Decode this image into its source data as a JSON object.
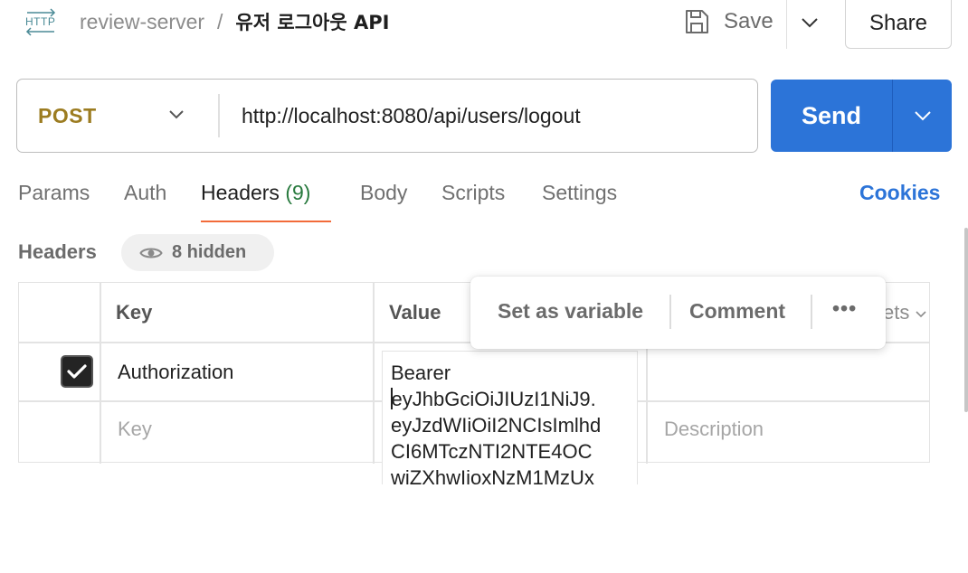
{
  "breadcrumb": {
    "icon": "http-icon",
    "collection": "review-server",
    "separator": "/",
    "request_name": "유저 로그아웃 API"
  },
  "toolbar": {
    "save_label": "Save",
    "share_label": "Share"
  },
  "request": {
    "method": "POST",
    "url": "http://localhost:8080/api/users/logout",
    "send_label": "Send"
  },
  "tabs": [
    {
      "label": "Params",
      "count": ""
    },
    {
      "label": "Auth",
      "count": ""
    },
    {
      "label": "Headers",
      "count": "(9)",
      "active": true
    },
    {
      "label": "Body",
      "count": ""
    },
    {
      "label": "Scripts",
      "count": ""
    },
    {
      "label": "Settings",
      "count": ""
    }
  ],
  "cookies_label": "Cookies",
  "headers_section": {
    "title": "Headers",
    "hidden_label": "8 hidden"
  },
  "table": {
    "columns": {
      "key": "Key",
      "value": "Value"
    },
    "rows": [
      {
        "checked": true,
        "key": "Authorization",
        "value_lines": [
          "Bearer",
          "eyJhbGciOiJIUzI1NiJ9.",
          "eyJzdWIiOiI2NCIsImlhd",
          "CI6MTczNTI2NTE4OC",
          "wiZXhwIjoxNzM1MzUx"
        ]
      }
    ],
    "placeholder": {
      "key": "Key",
      "description": "Description"
    }
  },
  "context_menu": {
    "items": [
      "Set as variable",
      "Comment"
    ],
    "more": "•••"
  },
  "bulk_edit_peek": "ets",
  "colors": {
    "accent_blue": "#2c74d8",
    "method_post": "#9c7c21",
    "tab_underline": "#f26b3a",
    "count_green": "#287a3e"
  }
}
